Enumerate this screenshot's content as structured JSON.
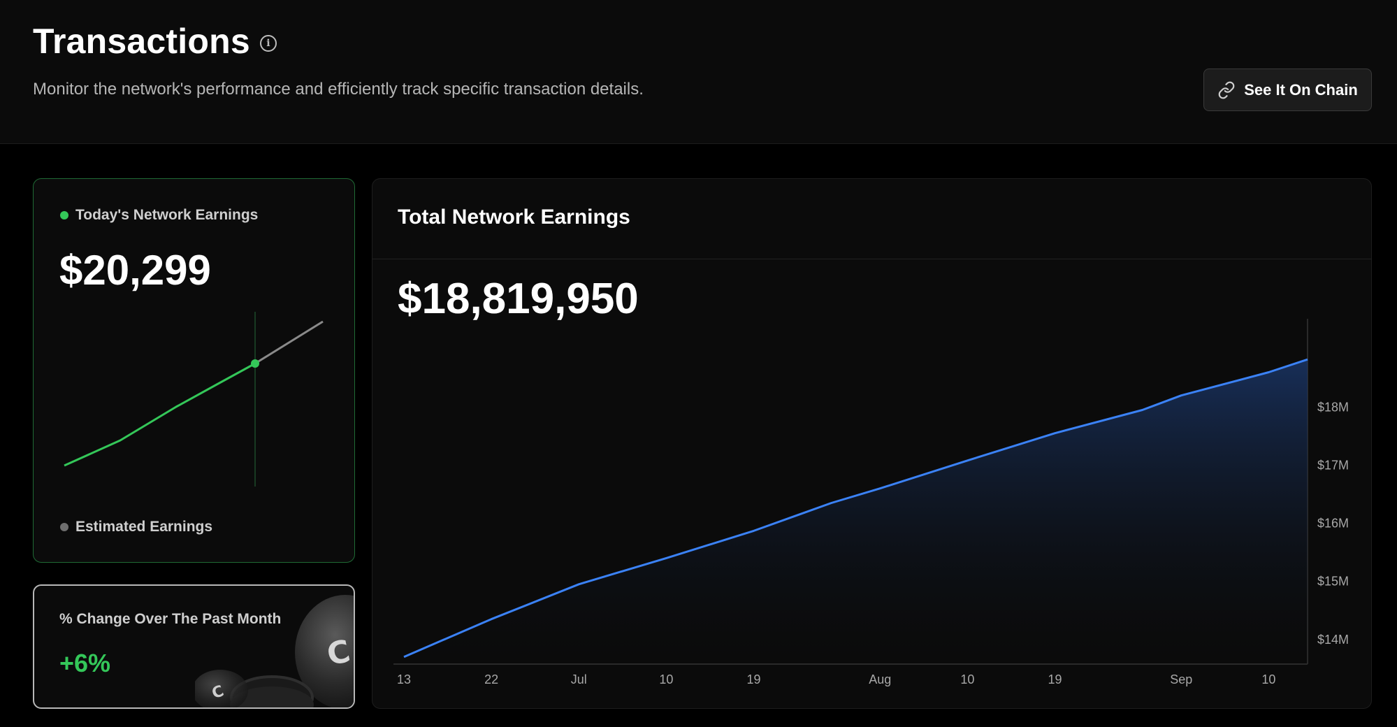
{
  "header": {
    "title": "Transactions",
    "info_icon": "info-icon",
    "subtitle": "Monitor the network's performance and efficiently track specific transaction details.",
    "chain_button": {
      "label": "See It On Chain",
      "icon": "link-icon"
    }
  },
  "today_card": {
    "legend_today": "Today's Network Earnings",
    "value": "$20,299",
    "legend_estimated": "Estimated Earnings",
    "colors": {
      "actual": "#34c759",
      "estimated": "#8a8a8a"
    }
  },
  "change_card": {
    "label": "% Change Over The Past Month",
    "value": "+6%"
  },
  "total_card": {
    "title": "Total Network Earnings",
    "value": "$18,819,950"
  },
  "chart_data": {
    "type": "area",
    "title": "Total Network Earnings",
    "x_tick_labels": [
      "13",
      "22",
      "Jul",
      "10",
      "19",
      "Aug",
      "10",
      "19",
      "Sep",
      "10"
    ],
    "y_tick_labels": [
      "$18M",
      "$17M",
      "$16M",
      "$15M",
      "$14M"
    ],
    "ylim": [
      13.6,
      19.4
    ],
    "y_unit": "$M",
    "series": [
      {
        "color": "#3b82f6",
        "points": [
          {
            "x": "Jun 13",
            "y": 13.7
          },
          {
            "x": "Jun 22",
            "y": 14.35
          },
          {
            "x": "Jul 1",
            "y": 14.95
          },
          {
            "x": "Jul 10",
            "y": 15.4
          },
          {
            "x": "Jul 19",
            "y": 15.87
          },
          {
            "x": "Jul 27",
            "y": 16.35
          },
          {
            "x": "Aug 1",
            "y": 16.6
          },
          {
            "x": "Aug 10",
            "y": 17.08
          },
          {
            "x": "Aug 19",
            "y": 17.55
          },
          {
            "x": "Aug 28",
            "y": 17.95
          },
          {
            "x": "Sep 1",
            "y": 18.2
          },
          {
            "x": "Sep 10",
            "y": 18.6
          },
          {
            "x": "Sep 14",
            "y": 18.82
          }
        ]
      }
    ],
    "grid": false,
    "axis_position": "right"
  }
}
